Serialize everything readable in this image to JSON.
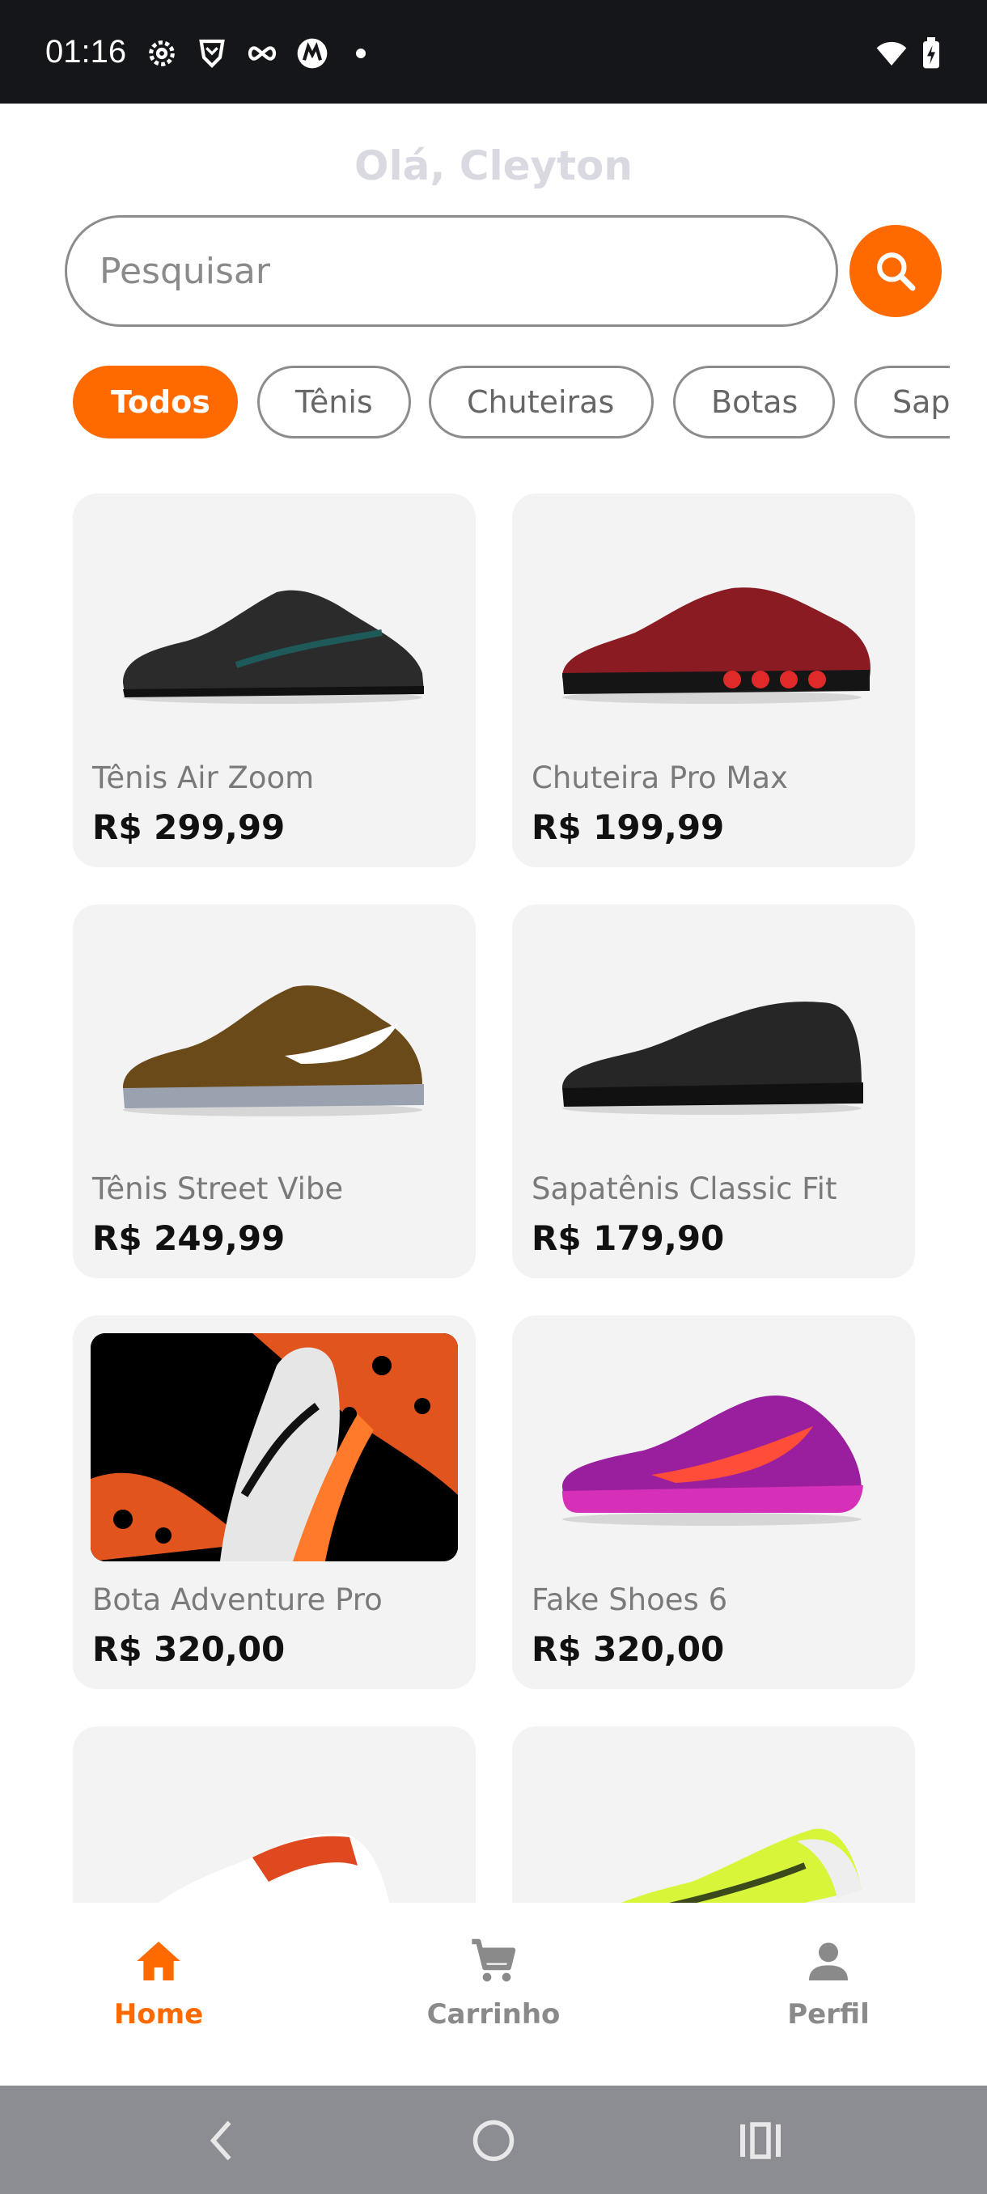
{
  "status_bar": {
    "time": "01:16",
    "icons": [
      "settings-icon",
      "brave-icon",
      "infinity-icon",
      "motorola-icon",
      "notification-dot",
      "wifi-icon",
      "battery-charging-icon"
    ]
  },
  "header": {
    "greeting": "Olá, Cleyton"
  },
  "search": {
    "placeholder": "Pesquisar",
    "value": "",
    "button_icon": "search-icon"
  },
  "categories": [
    {
      "label": "Todos",
      "active": true
    },
    {
      "label": "Tênis",
      "active": false
    },
    {
      "label": "Chuteiras",
      "active": false
    },
    {
      "label": "Botas",
      "active": false
    },
    {
      "label": "Sapatênis",
      "active": false
    }
  ],
  "products": [
    {
      "name": "Tênis Air Zoom",
      "price": "R$ 299,99"
    },
    {
      "name": "Chuteira Pro Max",
      "price": "R$ 199,99"
    },
    {
      "name": "Tênis Street Vibe",
      "price": "R$ 249,99"
    },
    {
      "name": "Sapatênis Classic Fit",
      "price": "R$ 179,90"
    },
    {
      "name": "Bota Adventure Pro",
      "price": "R$ 320,00"
    },
    {
      "name": "Fake Shoes 6",
      "price": "R$ 320,00"
    }
  ],
  "bottom_nav": [
    {
      "label": "Home",
      "icon": "home-icon",
      "active": true
    },
    {
      "label": "Carrinho",
      "icon": "cart-icon",
      "active": false
    },
    {
      "label": "Perfil",
      "icon": "person-icon",
      "active": false
    }
  ],
  "colors": {
    "accent": "#ff6a00",
    "card_bg": "#f3f3f3",
    "muted_text": "#7a7a7a"
  }
}
